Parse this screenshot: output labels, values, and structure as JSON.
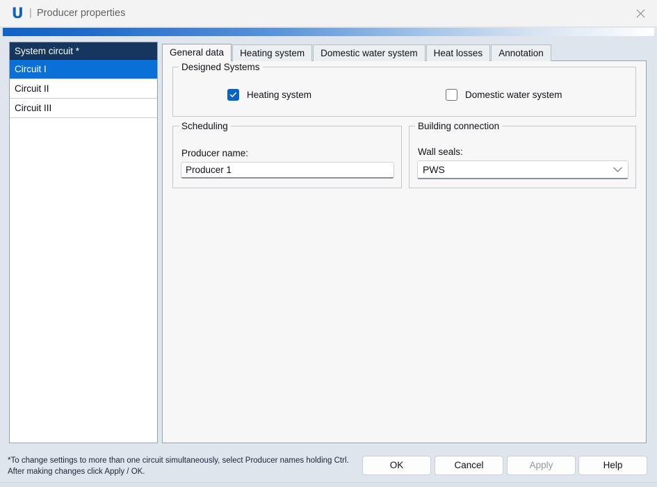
{
  "titlebar": {
    "logo_text": "U",
    "separator": "|",
    "title": "Producer properties",
    "close_icon": "close-icon"
  },
  "sidebar": {
    "header": "System circuit *",
    "items": [
      {
        "label": "Circuit I",
        "selected": true
      },
      {
        "label": "Circuit II",
        "selected": false
      },
      {
        "label": "Circuit III",
        "selected": false
      }
    ]
  },
  "tabs": [
    {
      "label": "General data",
      "active": true
    },
    {
      "label": "Heating system",
      "active": false
    },
    {
      "label": "Domestic water system",
      "active": false
    },
    {
      "label": "Heat losses",
      "active": false
    },
    {
      "label": "Annotation",
      "active": false
    }
  ],
  "designed_systems": {
    "group_title": "Designed Systems",
    "heating_label": "Heating system",
    "heating_checked": true,
    "dhw_label": "Domestic water system",
    "dhw_checked": false
  },
  "scheduling": {
    "group_title": "Scheduling",
    "producer_name_label": "Producer name:",
    "producer_name_value": "Producer 1",
    "producer_name_placeholder": ""
  },
  "building_connection": {
    "group_title": "Building connection",
    "wall_seals_label": "Wall seals:",
    "wall_seals_value": "PWS",
    "dropdown_icon": "chevron-down-icon"
  },
  "footer": {
    "note_line1": "*To change settings to more than one circuit simultaneously, select Producer names holding Ctrl.",
    "note_line2": "After making changes click Apply / OK.",
    "buttons": {
      "ok": "OK",
      "cancel": "Cancel",
      "apply": "Apply",
      "help": "Help"
    },
    "apply_enabled": false
  },
  "colors": {
    "accent_blue": "#1262c4",
    "selection_blue": "#0a70d8",
    "list_header_navy": "#14365f",
    "checkbox_blue": "#0a62c2",
    "dialog_bg": "#dfe5ec",
    "panel_bg": "#f7f7f7"
  }
}
